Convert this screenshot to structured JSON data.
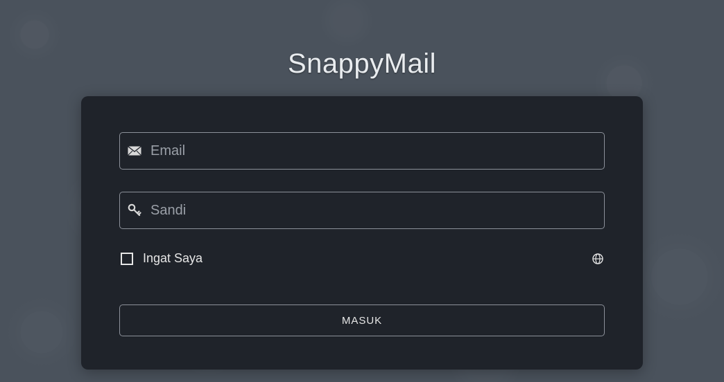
{
  "app": {
    "title": "SnappyMail"
  },
  "login": {
    "email_placeholder": "Email",
    "email_value": "",
    "password_placeholder": "Sandi",
    "password_value": "",
    "remember_label": "Ingat Saya",
    "submit_label": "MASUK"
  }
}
